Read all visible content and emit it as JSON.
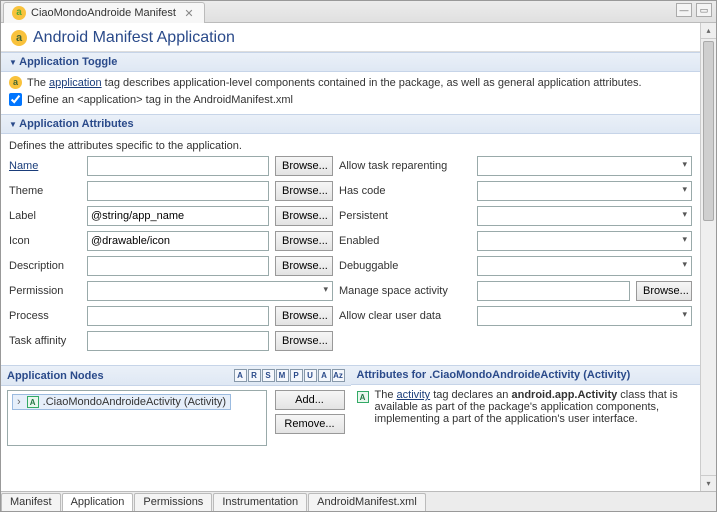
{
  "tab_top": {
    "title": "CiaoMondoAndroide Manifest"
  },
  "page_title": "Android Manifest Application",
  "toggle": {
    "section_title": "Application Toggle",
    "desc_pre": "The ",
    "desc_link": "application",
    "desc_post": " tag describes application-level components contained in the package, as well as general application attributes.",
    "checkbox_label": "Define an <application> tag in the AndroidManifest.xml"
  },
  "attributes": {
    "section_title": "Application Attributes",
    "intro": "Defines the attributes specific to the application.",
    "left_rows": [
      {
        "label": "Name",
        "link": true,
        "value": "",
        "browse": "Browse..."
      },
      {
        "label": "Theme",
        "link": false,
        "value": "",
        "browse": "Browse..."
      },
      {
        "label": "Label",
        "link": false,
        "value": "@string/app_name",
        "browse": "Browse..."
      },
      {
        "label": "Icon",
        "link": false,
        "value": "@drawable/icon",
        "browse": "Browse..."
      },
      {
        "label": "Description",
        "link": false,
        "value": "",
        "browse": "Browse..."
      },
      {
        "label": "Permission",
        "link": false,
        "value": "",
        "dropdown": true
      },
      {
        "label": "Process",
        "link": false,
        "value": "",
        "browse": "Browse..."
      },
      {
        "label": "Task affinity",
        "link": false,
        "value": "",
        "browse": "Browse..."
      }
    ],
    "right_rows": [
      {
        "label": "Allow task reparenting",
        "dropdown": true
      },
      {
        "label": "Has code",
        "dropdown": true
      },
      {
        "label": "Persistent",
        "dropdown": true
      },
      {
        "label": "Enabled",
        "dropdown": true
      },
      {
        "label": "Debuggable",
        "dropdown": true
      },
      {
        "label": "Manage space activity",
        "value": "",
        "browse": "Browse..."
      },
      {
        "label": "Allow clear user data",
        "dropdown": true
      }
    ]
  },
  "nodes": {
    "section_title": "Application Nodes",
    "filters": [
      "A",
      "R",
      "S",
      "M",
      "P",
      "U",
      "A",
      "Az"
    ],
    "tree_item": ".CiaoMondoAndroideActivity (Activity)",
    "buttons": {
      "add": "Add...",
      "remove": "Remove..."
    }
  },
  "attrs_for": {
    "section_title": "Attributes for .CiaoMondoAndroideActivity (Activity)",
    "text_pre": "The ",
    "text_link": "activity",
    "text_mid": " tag declares an ",
    "text_bold": "android.app.Activity",
    "text_post": " class that is available as part of the package's application components, implementing a part of the application's user interface."
  },
  "bottom_tabs": [
    "Manifest",
    "Application",
    "Permissions",
    "Instrumentation",
    "AndroidManifest.xml"
  ],
  "bottom_active": 1
}
